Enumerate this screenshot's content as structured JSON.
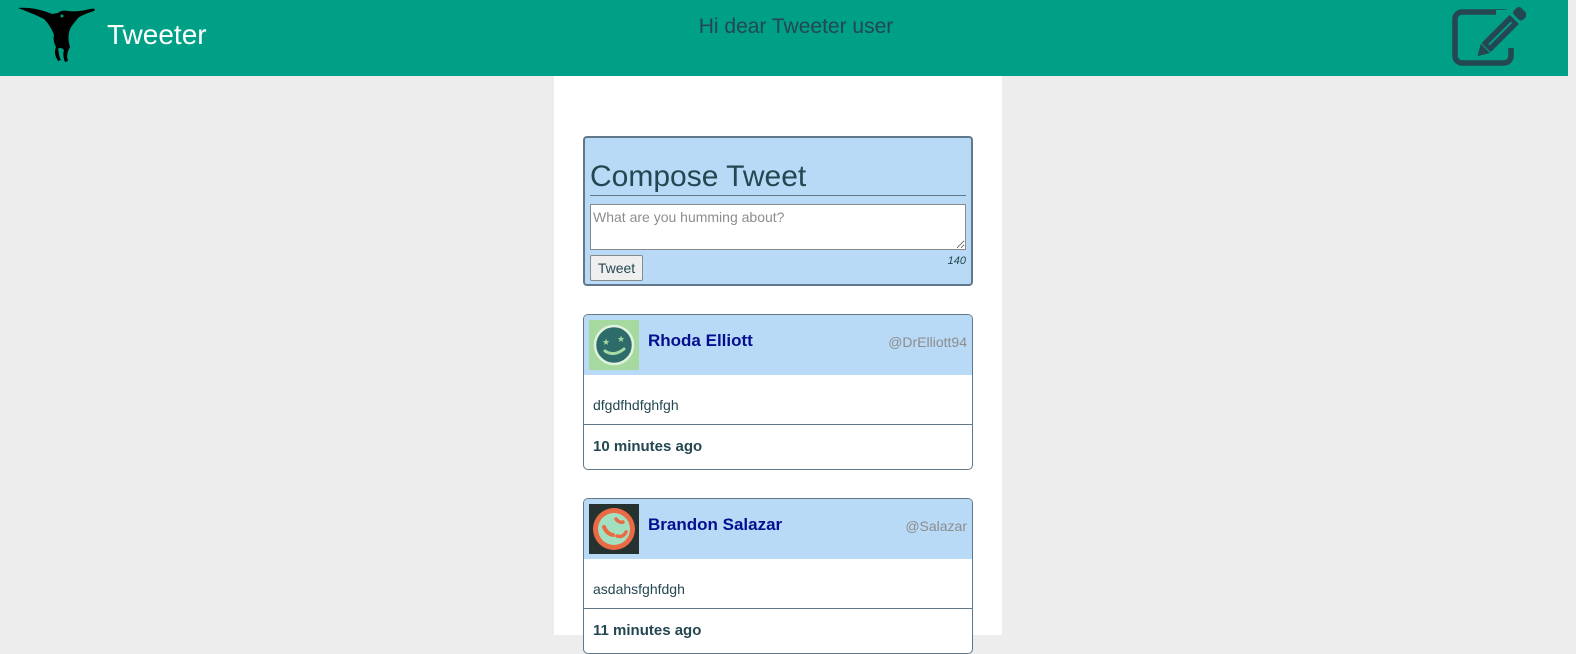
{
  "nav": {
    "brand": "Tweeter",
    "greeting": "Hi dear Tweeter user",
    "logo_icon": "hummingbird-logo-icon",
    "compose_icon": "pencil-square-icon"
  },
  "compose": {
    "title": "Compose Tweet",
    "placeholder": "What are you humming about?",
    "value": "",
    "button_label": "Tweet",
    "counter": "140"
  },
  "tweets": [
    {
      "name": "Rhoda Elliott",
      "handle": "@DrElliott94",
      "content": "dfgdfhdfghfgh",
      "time": "10 minutes ago",
      "avatar_colors": {
        "bg": "#a6d9a0",
        "face": "#2d6c6b",
        "accent": "#a6d9a0"
      }
    },
    {
      "name": "Brandon Salazar",
      "handle": "@Salazar",
      "content": "asdahsfghfdgh",
      "time": "11 minutes ago",
      "avatar_colors": {
        "bg": "#25322f",
        "face": "#ea6a45",
        "accent": "#a3e0c0"
      }
    }
  ],
  "colors": {
    "navbar": "#00a087",
    "panel": "#b8daf6",
    "name": "#030f8f",
    "text": "#244751"
  }
}
